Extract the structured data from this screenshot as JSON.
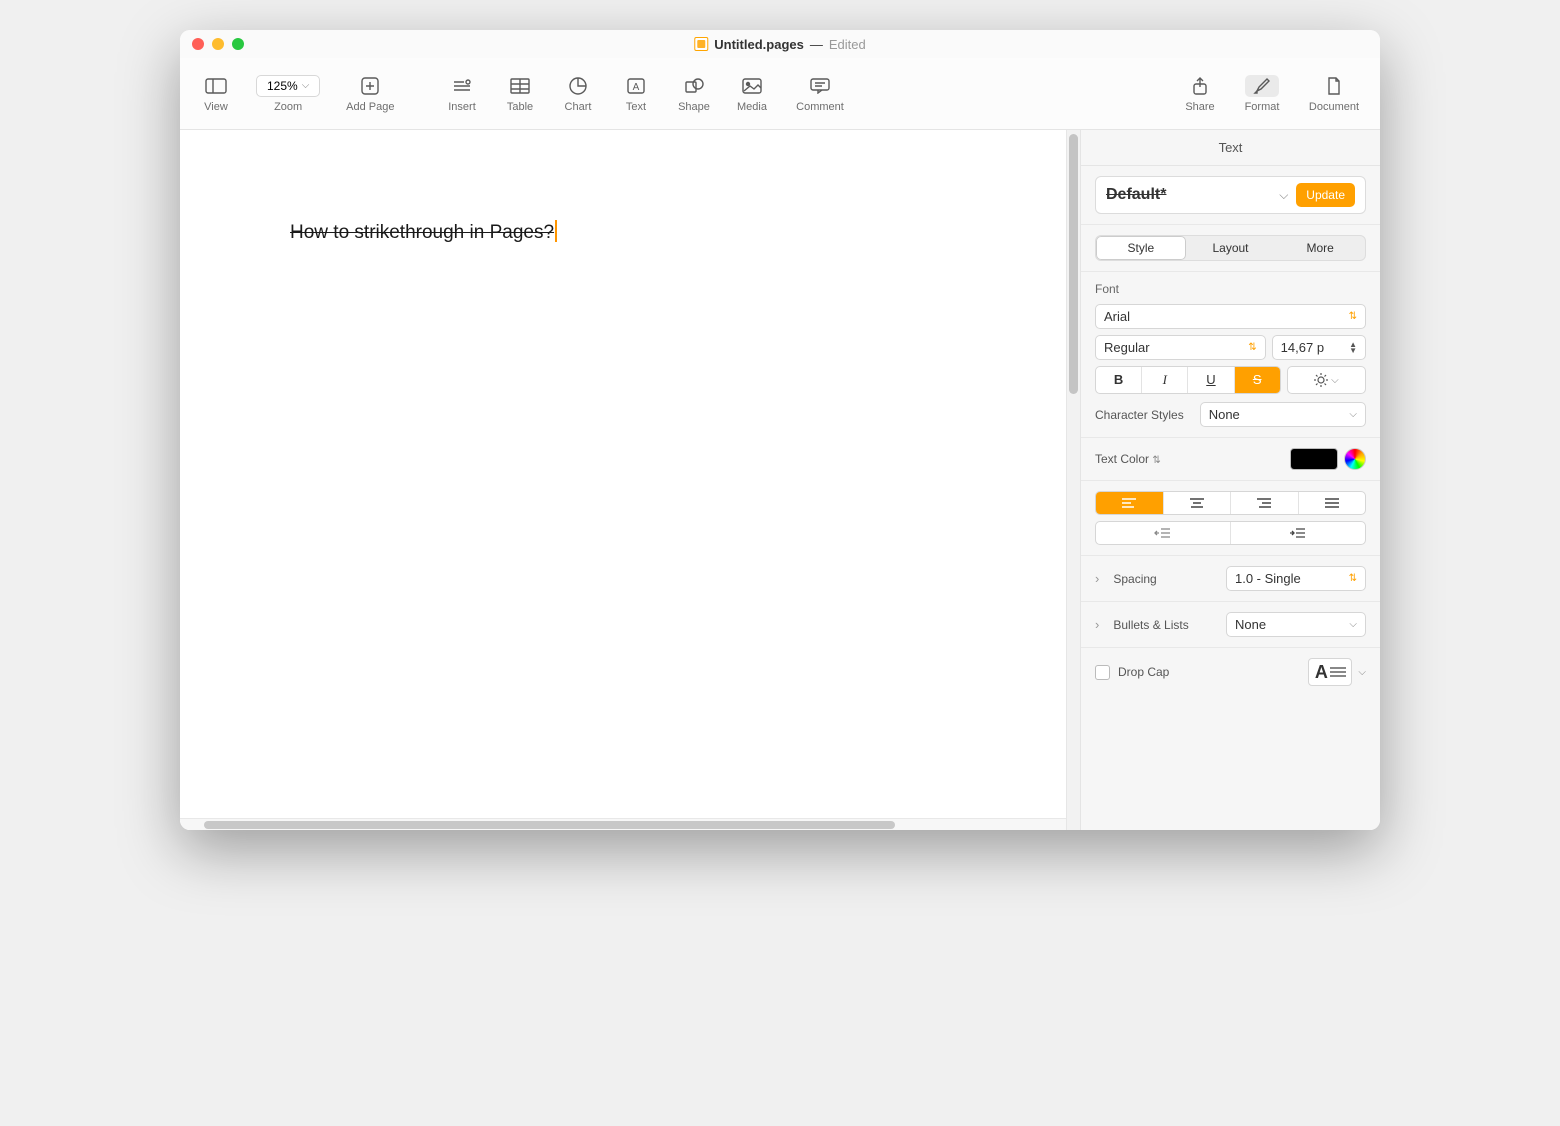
{
  "title": {
    "filename": "Untitled.pages",
    "status": "Edited"
  },
  "toolbar": {
    "view": "View",
    "zoom": "Zoom",
    "zoom_value": "125%",
    "add_page": "Add Page",
    "insert": "Insert",
    "table": "Table",
    "chart": "Chart",
    "text": "Text",
    "shape": "Shape",
    "media": "Media",
    "comment": "Comment",
    "share": "Share",
    "format": "Format",
    "document": "Document"
  },
  "document_text": "How to strikethrough in Pages?",
  "inspector": {
    "header": "Text",
    "paragraph_style": "Default*",
    "update_label": "Update",
    "tabs": {
      "style": "Style",
      "layout": "Layout",
      "more": "More"
    },
    "font_section": "Font",
    "font_family": "Arial",
    "font_weight": "Regular",
    "font_size": "14,67 p",
    "bius": {
      "b": "B",
      "i": "I",
      "u": "U",
      "s": "S"
    },
    "char_styles_label": "Character Styles",
    "char_styles_value": "None",
    "text_color_label": "Text Color",
    "text_color_value": "#000000",
    "spacing_label": "Spacing",
    "spacing_value": "1.0 - Single",
    "bullets_label": "Bullets & Lists",
    "bullets_value": "None",
    "dropcap_label": "Drop Cap",
    "dropcap_checked": false
  },
  "colors": {
    "accent": "#ffa000"
  }
}
